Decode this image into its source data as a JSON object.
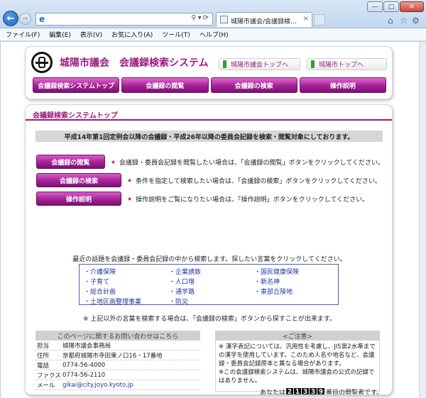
{
  "browser": {
    "address_value": "",
    "tab_title": "城陽市議会/会議録検索シ...",
    "tab_close": "×",
    "menu": [
      "ファイル(F)",
      "編集(E)",
      "表示(V)",
      "お気に入り(A)",
      "ツール(T)",
      "ヘルプ(H)"
    ]
  },
  "header": {
    "title": "城陽市議会　会議録検索システム",
    "links": [
      "城陽市議会トップへ",
      "城陽市トップへ"
    ],
    "nav": [
      "会議録検索システムトップ",
      "会議録の閲覧",
      "会議録の検索",
      "操作説明"
    ]
  },
  "main": {
    "section_title": "会議録検索システムトップ",
    "announcement": "平成14年第1回定例会以降の会議録・平成26年以降の委員会記録を検索・閲覧対象にしております。",
    "actions": [
      {
        "label": "会議録の閲覧",
        "desc": "会議録・委員会記録を閲覧したい場合は、「会議録の閲覧」ボタンをクリックしてください。"
      },
      {
        "label": "会議録の検索",
        "desc": "条件を指定して検索したい場合は、「会議録の検索」ボタンをクリックしてください。"
      },
      {
        "label": "操作説明",
        "desc": "操作説明をご覧になりたい場合は、「操作説明」ボタンをクリックしてください。"
      }
    ],
    "topics_intro": "最近の話題を会議録・委員会記録の中から検索します。探したい言葉をクリックしてください。",
    "topics": [
      "・介護保険",
      "・企業誘致",
      "・国民健康保険",
      "・子育て",
      "・人口増",
      "・新名神",
      "・総合計画",
      "・通学路",
      "・東部丘陵地",
      "・土地区画整理事業",
      "・防災"
    ],
    "hint": "※ 上記以外の言葉を検索する場合は、「会議録の検索」ボタンから探すことが出来ます。"
  },
  "contact": {
    "heading": "このページに関するお問い合わせはこちら",
    "rows": [
      {
        "label": "担当",
        "value": "城陽市議会事務局"
      },
      {
        "label": "住所",
        "value": "京都府城陽市寺田東ノ口16・17番地"
      },
      {
        "label": "電話",
        "value": "0774-56-4000"
      },
      {
        "label": "ファクス",
        "value": "0774-56-2110"
      },
      {
        "label": "メール",
        "value": "gikai@city.joyo.kyoto.jp"
      }
    ]
  },
  "caution": {
    "heading": "<ご注意>",
    "lines": [
      "※ 漢字表記については、汎用性を考慮し、JIS第2水準までの漢字を使用しています。このため人名や地名など、会議録・委員会記録原本と異なる場合があります。",
      "※この会議録検索システムは、城陽市議会の公式の記録ではありません。"
    ]
  },
  "counter": {
    "prefix": "あなたは",
    "digits": [
      "2",
      "1",
      "3",
      "3",
      "9"
    ],
    "suffix": "番目の閲覧者です。"
  }
}
